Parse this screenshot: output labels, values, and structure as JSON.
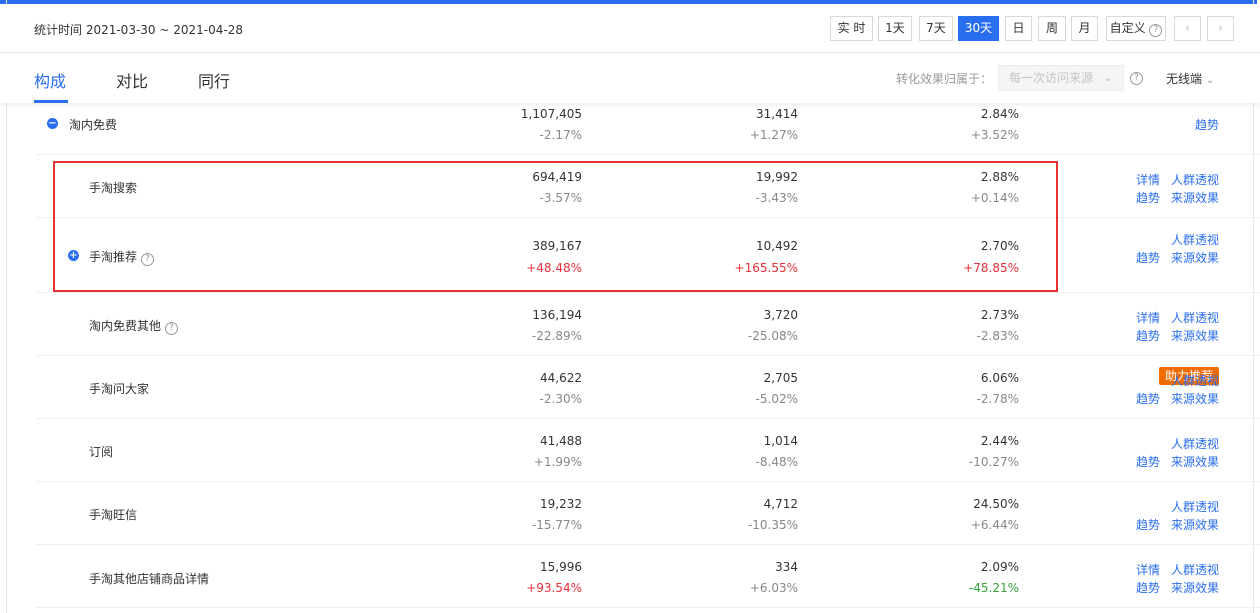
{
  "header": {
    "stat_time_label": "统计时间 2021-03-30 ~ 2021-04-28",
    "ranges": [
      "实 时",
      "1天",
      "7天",
      "30天",
      "日",
      "周",
      "月",
      "自定义"
    ],
    "active_range": "30天",
    "prev_icon": "‹",
    "next_icon": "›"
  },
  "tabs": {
    "items": [
      "构成",
      "对比",
      "同行"
    ],
    "active": "构成",
    "attr_label": "转化效果归属于：",
    "attr_select_placeholder": "每一次访问来源",
    "device_label": "无线端"
  },
  "colors": {
    "accent": "#2a6ef0",
    "up": "#e8313a",
    "down_green": "#36a33a",
    "badge": "#f06b00",
    "highlight": "#e63232"
  },
  "rows": [
    {
      "name": "淘内免费",
      "v1": "1,107,405",
      "c1": "-2.17%",
      "v2": "31,414",
      "c2": "+1.27%",
      "v3": "2.84%",
      "c3": "+3.52%",
      "links": [
        "趋势"
      ]
    },
    {
      "name": "手淘搜索",
      "v1": "694,419",
      "c1": "-3.57%",
      "v2": "19,992",
      "c2": "-3.43%",
      "v3": "2.88%",
      "c3": "+0.14%",
      "links": [
        "详情",
        "人群透视",
        "趋势",
        "来源效果"
      ]
    },
    {
      "name": "手淘推荐",
      "v1": "389,167",
      "c1": "+48.48%",
      "v2": "10,492",
      "c2": "+165.55%",
      "v3": "2.70%",
      "c3": "+78.85%",
      "links": [
        "人群透视",
        "趋势",
        "来源效果"
      ],
      "badge": "助力推荐"
    },
    {
      "name": "淘内免费其他",
      "v1": "136,194",
      "c1": "-22.89%",
      "v2": "3,720",
      "c2": "-25.08%",
      "v3": "2.73%",
      "c3": "-2.83%",
      "links": [
        "详情",
        "人群透视",
        "趋势",
        "来源效果"
      ]
    },
    {
      "name": "手淘问大家",
      "v1": "44,622",
      "c1": "-2.30%",
      "v2": "2,705",
      "c2": "-5.02%",
      "v3": "6.06%",
      "c3": "-2.78%",
      "links": [
        "人群透视",
        "趋势",
        "来源效果"
      ]
    },
    {
      "name": "订阅",
      "v1": "41,488",
      "c1": "+1.99%",
      "v2": "1,014",
      "c2": "-8.48%",
      "v3": "2.44%",
      "c3": "-10.27%",
      "links": [
        "人群透视",
        "趋势",
        "来源效果"
      ]
    },
    {
      "name": "手淘旺信",
      "v1": "19,232",
      "c1": "-15.77%",
      "v2": "4,712",
      "c2": "-10.35%",
      "v3": "24.50%",
      "c3": "+6.44%",
      "links": [
        "人群透视",
        "趋势",
        "来源效果"
      ]
    },
    {
      "name": "手淘其他店铺商品详情",
      "v1": "15,996",
      "c1": "+93.54%",
      "v2": "334",
      "c2": "+6.03%",
      "v3": "2.09%",
      "c3": "-45.21%",
      "links": [
        "详情",
        "人群透视",
        "趋势",
        "来源效果"
      ]
    }
  ]
}
